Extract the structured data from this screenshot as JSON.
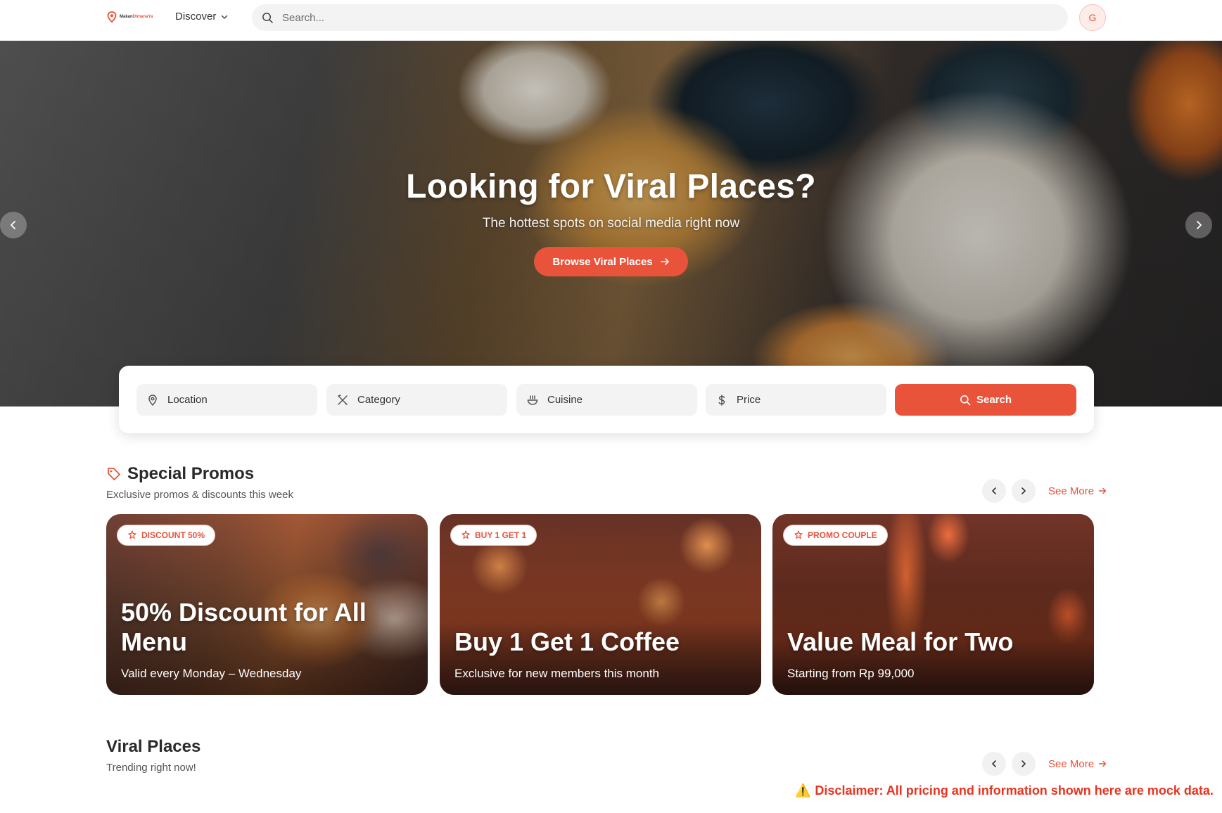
{
  "brand": {
    "logo_text_main": "Makan",
    "logo_text_accent": "DimanaYa",
    "accent_color": "#e8533a"
  },
  "header": {
    "discover_label": "Discover",
    "search_placeholder": "Search...",
    "avatar_initial": "G"
  },
  "hero": {
    "title": "Looking for Viral Places?",
    "subtitle": "The hottest spots on social media right now",
    "cta_label": "Browse Viral Places"
  },
  "filters": {
    "location": "Location",
    "category": "Category",
    "cuisine": "Cuisine",
    "price": "Price",
    "search_label": "Search"
  },
  "promos": {
    "title": "Special Promos",
    "subtitle": "Exclusive promos & discounts this week",
    "see_more": "See More",
    "cards": [
      {
        "badge": "DISCOUNT 50%",
        "title": "50% Discount for All Menu",
        "subtitle": "Valid every Monday – Wednesday"
      },
      {
        "badge": "BUY 1 GET 1",
        "title": "Buy 1 Get 1 Coffee",
        "subtitle": "Exclusive for new members this month"
      },
      {
        "badge": "PROMO COUPLE",
        "title": "Value Meal for Two",
        "subtitle": "Starting from Rp 99,000"
      }
    ]
  },
  "viral": {
    "title": "Viral Places",
    "subtitle": "Trending right now!",
    "see_more": "See More"
  },
  "disclaimer": {
    "icon": "⚠️",
    "text": "Disclaimer: All pricing and information shown here are mock data."
  }
}
